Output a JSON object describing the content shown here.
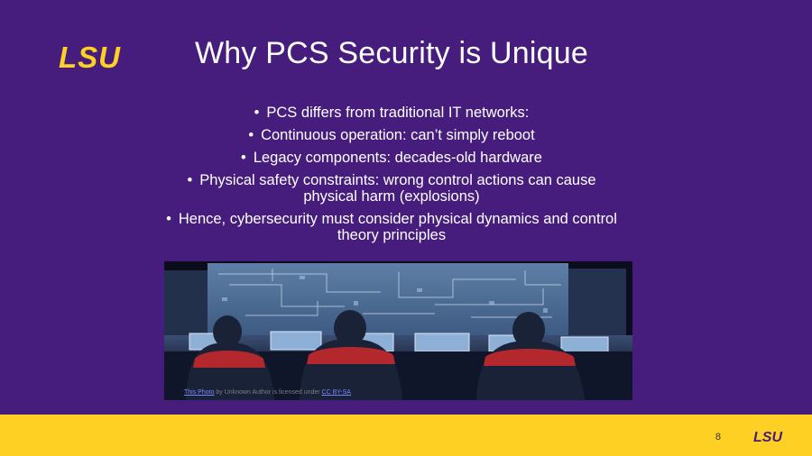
{
  "slide": {
    "title": "Why PCS Security is Unique",
    "logo_text": "LSU",
    "bullets": [
      "PCS differs from traditional IT networks:",
      "Continuous operation: can’t simply reboot",
      "Legacy components: decades-old hardware",
      "Physical safety constraints: wrong control actions can cause physical harm (explosions)",
      "Hence, cybersecurity must consider physical dynamics and control theory principles"
    ],
    "bullet_char": "•",
    "page_number": "8"
  },
  "photo": {
    "credit_link": "This Photo",
    "credit_middle": " by Unknown Author is licensed under ",
    "credit_license": "CC BY-SA"
  },
  "colors": {
    "background": "#461d7c",
    "accent_gold": "#fdd023",
    "text": "#ffffff"
  }
}
